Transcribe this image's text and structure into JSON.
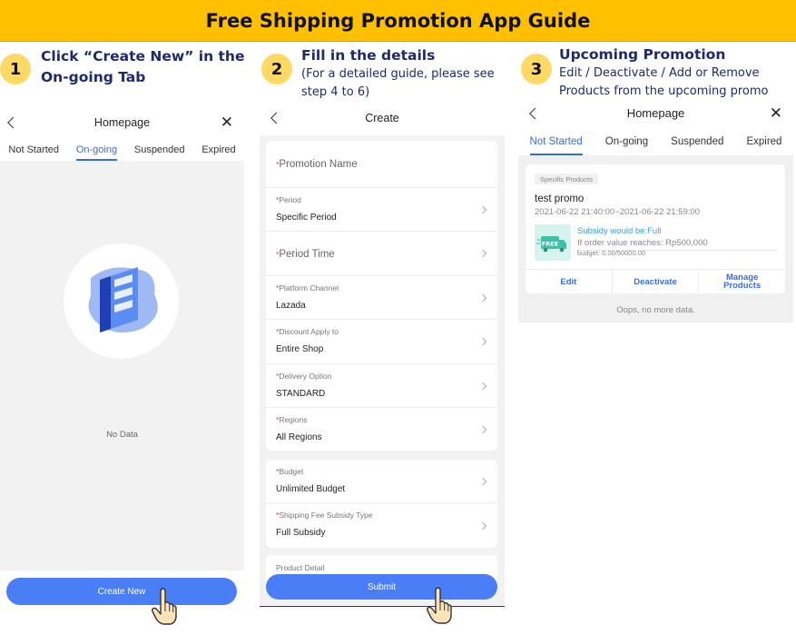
{
  "banner": {
    "title": "Free Shipping Promotion App Guide"
  },
  "steps": [
    {
      "number": "1",
      "title_line1": "Click “Create New” in the",
      "title_line2": "On-going Tab"
    },
    {
      "number": "2",
      "title": "Fill in the details",
      "sub_line1": "(For a detailed guide, please see",
      "sub_line2": "step 4 to 6)"
    },
    {
      "number": "3",
      "title": "Upcoming Promotion",
      "sub_line1": "Edit / Deactivate / Add or Remove",
      "sub_line2": "Products from the upcoming promo"
    }
  ],
  "screen1": {
    "nav_title": "Homepage",
    "close_glyph": "✕",
    "tabs": [
      "Not Started",
      "On-going",
      "Suspended",
      "Expired"
    ],
    "active_tab": "On-going",
    "empty_text": "No Data",
    "create_button": "Create New"
  },
  "screen2": {
    "nav_title": "Create",
    "fields": {
      "promotion_name": "Promotion Name",
      "period_label": "Period",
      "period_value": "Specific Period",
      "period_time": "Period Time",
      "platform_label": "Platform Channel",
      "platform_value": "Lazada",
      "discount_label": "Discount Apply to",
      "discount_value": "Entire Shop",
      "delivery_label": "Delivery Option",
      "delivery_value": "STANDARD",
      "regions_label": "Regions",
      "regions_value": "All Regions",
      "budget_label": "Budget",
      "budget_value": "Unlimited Budget",
      "subsidy_label": "Shipping Fee Subsidy Type",
      "subsidy_value": "Full Subsidy",
      "product_detail_partial": "Product Detail"
    },
    "required_mark": "*",
    "submit_button": "Submit"
  },
  "screen3": {
    "nav_title": "Homepage",
    "close_glyph": "✕",
    "tabs": [
      "Not Started",
      "On-going",
      "Suspended",
      "Expired"
    ],
    "active_tab": "Not Started",
    "card": {
      "chip": "Specific Products",
      "name": "test promo",
      "time": "2021-06-22 21:40:00~2021-06-22 21:59:00",
      "free_badge": "FREE",
      "subsidy": "Subsidy would be:Full",
      "condition": "If order value reaches: Rp500,000",
      "budget": "budget: 0.00/50000.00",
      "actions": {
        "edit": "Edit",
        "deactivate": "Deactivate",
        "manage_line1": "Manage",
        "manage_line2": "Products"
      }
    },
    "footer": "Oops, no more data."
  },
  "colors": {
    "banner": "#ffc000",
    "step_badge": "#ffd966",
    "title_text": "#1f2a6b",
    "accent_blue": "#4a7ef6",
    "tab_active": "#3a6cd9",
    "required": "#e5473c"
  }
}
